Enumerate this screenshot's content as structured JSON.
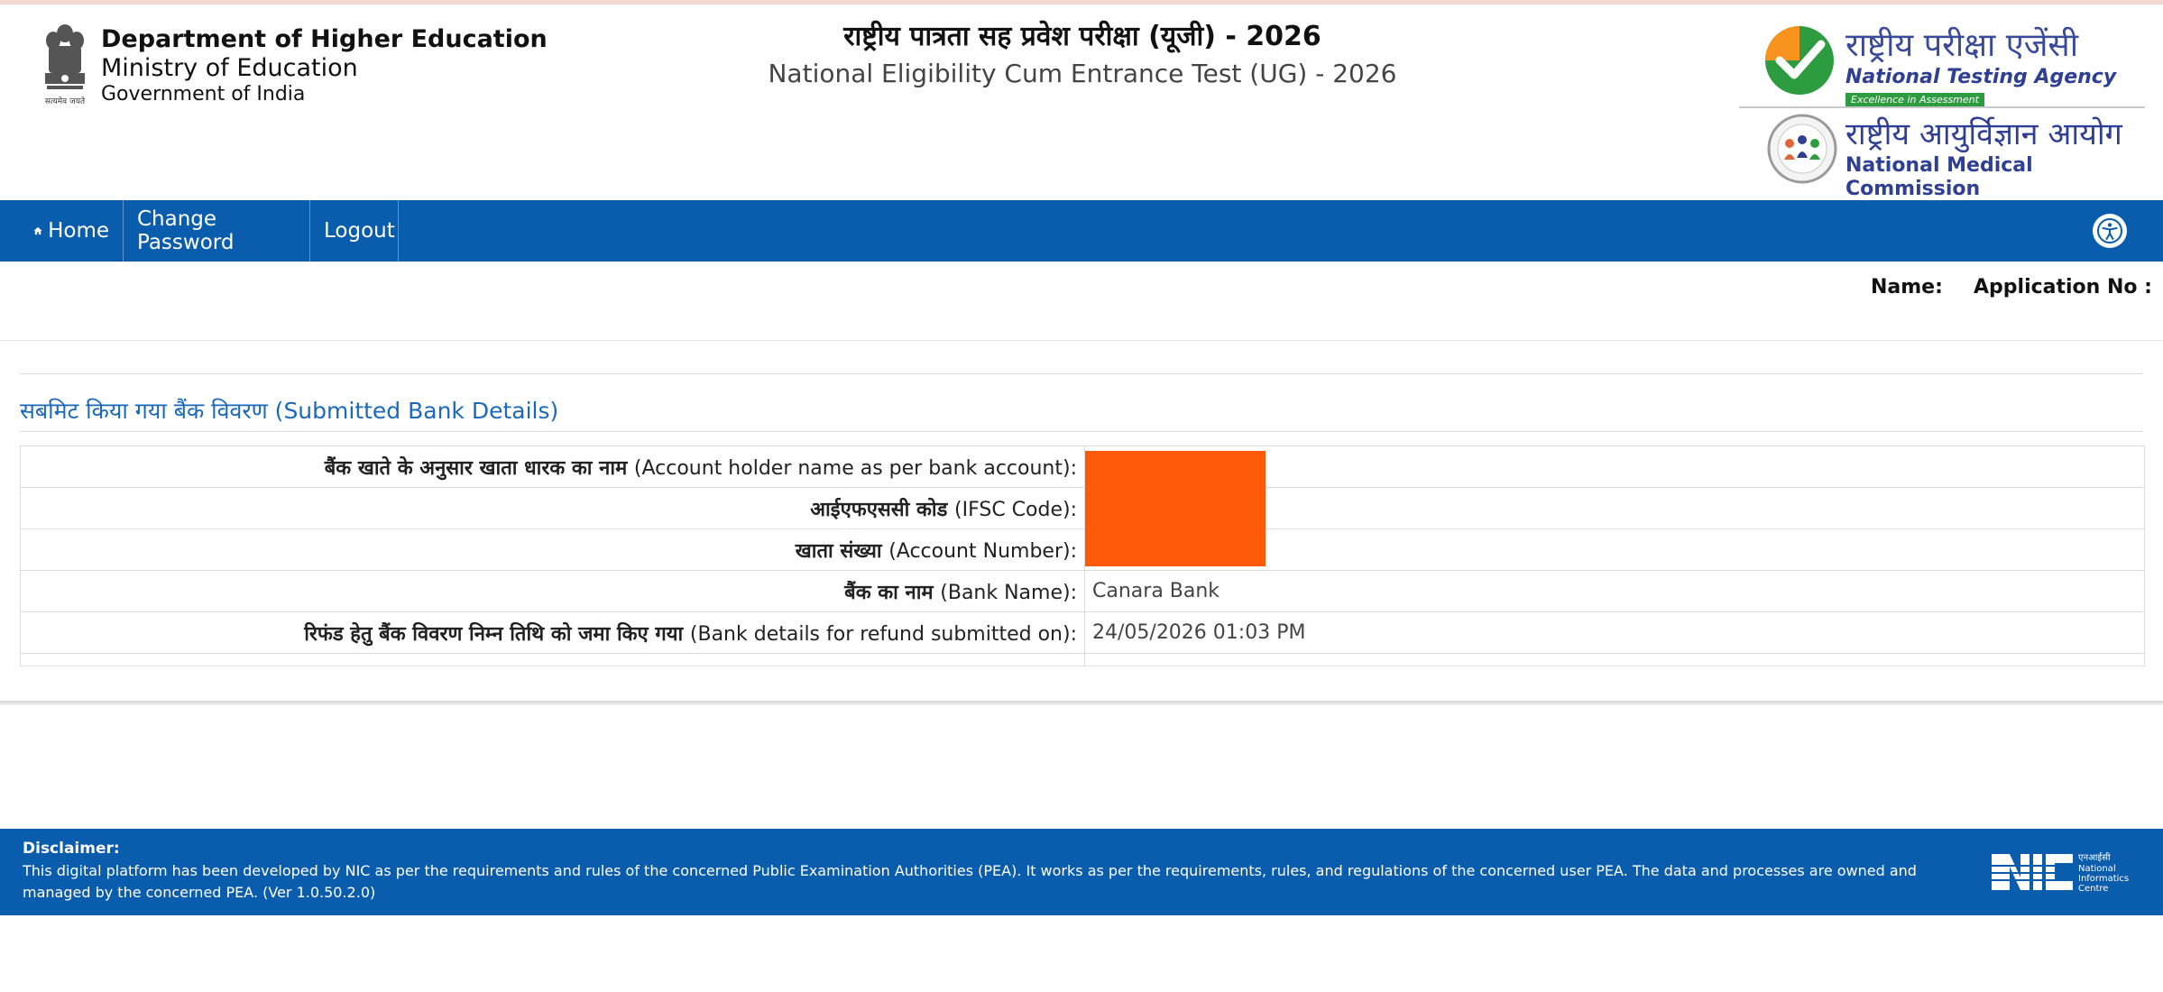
{
  "header": {
    "dept_line1": "Department of Higher Education",
    "dept_line2": "Ministry of Education",
    "dept_line3": "Government of India",
    "title_hindi": "राष्ट्रीय पात्रता सह प्रवेश परीक्षा (यूजी) - 2026",
    "title_english": "National Eligibility Cum Entrance Test (UG) - 2026",
    "nta_hindi": "राष्ट्रीय परीक्षा एजेंसी",
    "nta_english": "National Testing Agency",
    "nta_tagline": "Excellence in Assessment",
    "nmc_hindi": "राष्ट्रीय आयुर्विज्ञान आयोग",
    "nmc_english": "National Medical Commission"
  },
  "nav": {
    "home": "Home",
    "change_password": "Change Password",
    "logout": "Logout"
  },
  "user": {
    "name_label": "Name:",
    "application_label": "Application No :"
  },
  "section": {
    "title": "सबमिट किया गया बैंक विवरण (Submitted Bank Details)"
  },
  "bank_details": [
    {
      "label_hi": "बैंक खाते के अनुसार खाता धारक का नाम",
      "label_en": "(Account holder name as per bank account):",
      "value": ""
    },
    {
      "label_hi": "आईएफएससी कोड",
      "label_en": "(IFSC Code):",
      "value": ""
    },
    {
      "label_hi": "खाता संख्या",
      "label_en": "(Account Number):",
      "value": ""
    },
    {
      "label_hi": "बैंक का नाम",
      "label_en": "(Bank Name):",
      "value": "Canara Bank"
    },
    {
      "label_hi": "रिफंड हेतु बैंक विवरण निम्न तिथि को जमा किए गया",
      "label_en": "(Bank details for refund submitted on):",
      "value": "24/05/2026 01:03 PM"
    }
  ],
  "footer": {
    "disclaimer_title": "Disclaimer:",
    "disclaimer_text": "This digital platform has been developed by NIC as per the requirements and rules of the concerned Public Examination Authorities (PEA). It works as per the requirements, rules, and regulations of the concerned user PEA. The data and processes are owned and managed by the concerned PEA. (Ver 1.0.50.2.0)",
    "nic_hindi": "एनआईसी",
    "nic_english_1": "National",
    "nic_english_2": "Informatics",
    "nic_english_3": "Centre"
  },
  "colors": {
    "nav_blue": "#0a5cad",
    "section_title": "#1b69b8",
    "redaction": "#ff5a0a"
  },
  "icons": [
    "national-emblem-icon",
    "home-icon",
    "accessibility-icon",
    "nta-logo-icon",
    "nmc-logo-icon",
    "nic-logo-icon"
  ]
}
